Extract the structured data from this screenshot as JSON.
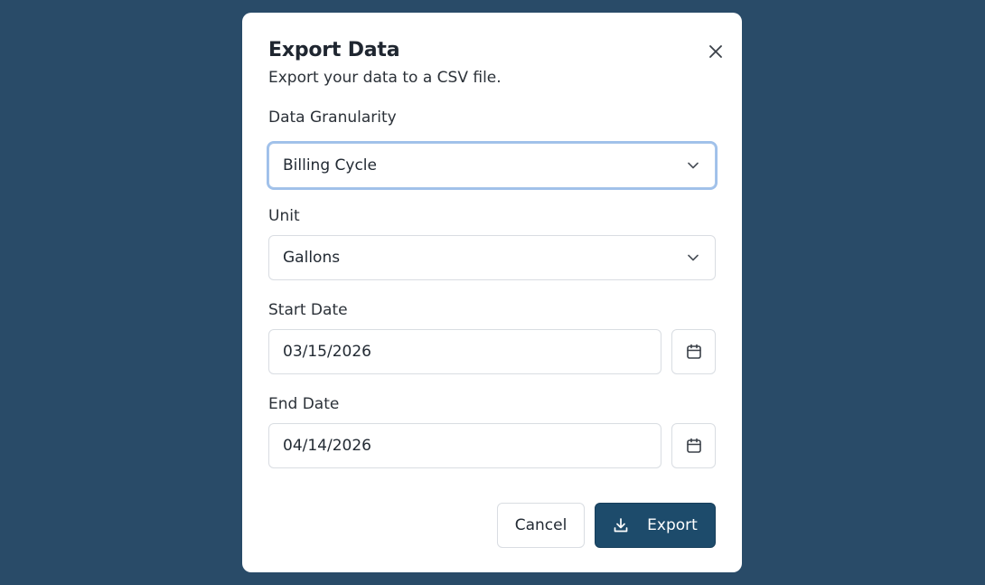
{
  "dialog": {
    "title": "Export Data",
    "subtitle": "Export your data to a CSV file.",
    "close_icon": "close-icon"
  },
  "granularity": {
    "label": "Data Granularity",
    "value": "Billing Cycle"
  },
  "unit": {
    "label": "Unit",
    "value": "Gallons"
  },
  "start_date": {
    "label": "Start Date",
    "value": "03/15/2026"
  },
  "end_date": {
    "label": "End Date",
    "value": "04/14/2026"
  },
  "actions": {
    "cancel_label": "Cancel",
    "export_label": "Export"
  },
  "colors": {
    "backdrop": "#294b68",
    "primary": "#1d4b6b",
    "focus_ring": "#9fc0ea"
  }
}
